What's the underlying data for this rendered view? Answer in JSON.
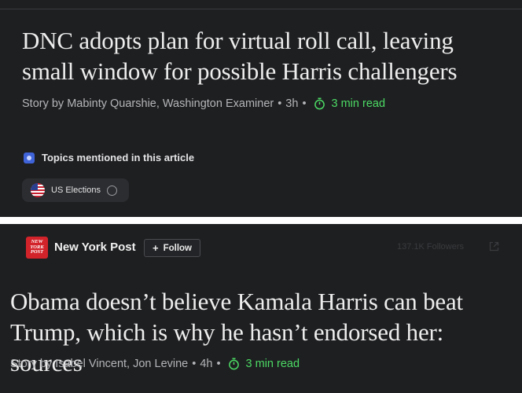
{
  "article_top": {
    "headline": "DNC adopts plan for virtual roll call, leaving small window for possible Harris challengers",
    "byline_prefix": "Story by Mabinty Quarshie, Washington Examiner",
    "age": "3h",
    "read_time": "3 min read",
    "topics_heading": "Topics mentioned in this article",
    "topics": [
      {
        "label": "US Elections"
      }
    ]
  },
  "article_bottom": {
    "publisher": {
      "name": "New York Post",
      "logo_text": [
        "NEW",
        "YORK",
        "POST"
      ],
      "follow_label": "Follow",
      "followers": "137.1K Followers"
    },
    "headline": "Obama doesn’t believe Kamala Harris can beat Trump, which is why he hasn’t endorsed her: sources",
    "byline_prefix": "Story by Isabel Vincent, Jon Levine",
    "age": "4h",
    "read_time": "3 min read"
  },
  "colors": {
    "panel_bg": "#1e1f21",
    "read_time_green": "#4cd964",
    "logo_red": "#d2232a"
  },
  "icons": [
    "clock-icon",
    "topics-icon",
    "us-flag-icon",
    "circle-icon",
    "plus-icon",
    "external-link-icon"
  ]
}
